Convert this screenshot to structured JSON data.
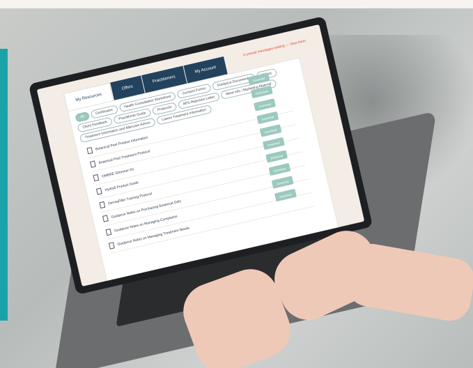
{
  "screen": {
    "tabs": [
      "My Resources",
      "Offers",
      "Practitioners",
      "My Account"
    ],
    "notice": "4 unread messages waiting — View them",
    "chips": [
      "All",
      "Certificates",
      "Health Consultation Worksheet",
      "Consent Forms",
      "Guidance Documents",
      "Videos",
      "Client Feedback",
      "Practitioner Guide",
      "Protocols",
      "NFS Rejection Letter",
      "More Info / Marketing Material",
      "Treatment Information and Aftercare Advice",
      "Lasers Treatment Information"
    ],
    "rows": [
      "Botanical Peel Product Information",
      "Botanical Peel Treatment Protocol",
      "OMBRE Shimmer Kit",
      "Hydra5 Product Guide",
      "DermaFiller Training Protocol",
      "Guidance Notes on Purchasing Botanical Gels",
      "Guidance Notes on Managing Complaints",
      "Guidance Notes on Managing Treatment Needs"
    ],
    "button_label": "Download"
  }
}
